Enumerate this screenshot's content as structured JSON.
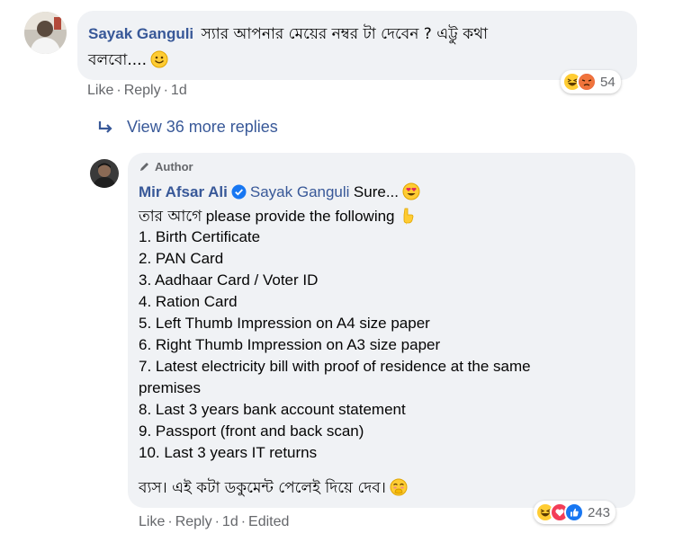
{
  "comment1": {
    "author": "Sayak Ganguli",
    "text_line1": "স্যার আপনার মেয়ের নম্বর টা দেবেন ? এট্টু কথা",
    "text_line2": "বলবো....",
    "actions": {
      "like": "Like",
      "reply": "Reply",
      "time": "1d"
    },
    "reactions": {
      "icons": [
        "haha-icon",
        "angry-icon"
      ],
      "count": "54"
    }
  },
  "view_more": {
    "label": "View 36 more replies"
  },
  "comment2": {
    "author_badge": "Author",
    "author": "Mir Afsar Ali",
    "mention": "Sayak Ganguli",
    "intro": "Sure...",
    "line2_bn": "তার আগে",
    "line2_en": "please provide the following",
    "items": [
      "1. Birth Certificate",
      "2. PAN Card",
      "3. Aadhaar Card / Voter ID",
      "4. Ration Card",
      "5. Left Thumb Impression on A4 size paper",
      "6. Right Thumb Impression on A3 size paper",
      "7. Latest electricity bill with proof of residence at the same",
      "premises",
      "8. Last 3 years bank account statement",
      "9. Passport (front and back scan)",
      "10. Last 3 years IT returns"
    ],
    "closing": "ব্যস। এই কটা ডকুমেন্ট পেলেই দিয়ে দেব।",
    "actions": {
      "like": "Like",
      "reply": "Reply",
      "time": "1d",
      "edited": "Edited"
    },
    "reactions": {
      "icons": [
        "haha-icon",
        "love-icon",
        "like-icon"
      ],
      "count": "243"
    }
  },
  "colors": {
    "bubble": "#f0f2f5",
    "name": "#385898",
    "meta": "#65676b",
    "verified": "#1877f2"
  }
}
